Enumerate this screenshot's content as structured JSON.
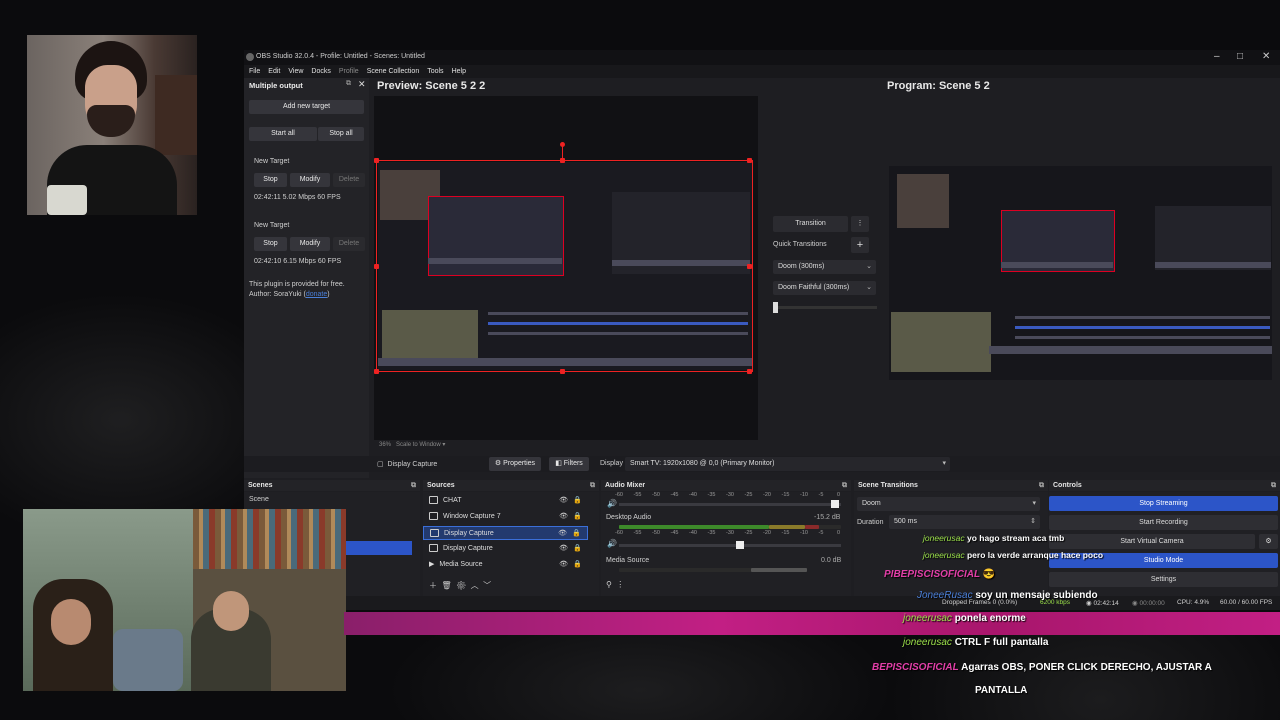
{
  "window": {
    "title": "OBS Studio 32.0.4 - Profile: Untitled - Scenes: Untitled",
    "controls": [
      "–",
      "□",
      "✕"
    ]
  },
  "menu": [
    "File",
    "Edit",
    "View",
    "Docks",
    "Profile",
    "Scene Collection",
    "Tools",
    "Help"
  ],
  "multiple_output": {
    "title": "Multiple output",
    "add_target": "Add new target",
    "start_all": "Start all",
    "stop_all": "Stop all",
    "targets": [
      {
        "name": "New Target",
        "stop": "Stop",
        "modify": "Modify",
        "delete": "Delete",
        "stats": "02:42:11  5.02 Mbps  60 FPS"
      },
      {
        "name": "New Target",
        "stop": "Stop",
        "modify": "Modify",
        "delete": "Delete",
        "stats": "02:42:10  6.15 Mbps  60 FPS"
      }
    ],
    "plugin_note": "This plugin is provided for free.",
    "author": "Author: SoraYuki (",
    "donate": "donate",
    "author_end": ")"
  },
  "preview": {
    "title": "Preview: Scene 5 2 2",
    "zoom": "36%",
    "scale_mode": "Scale to Window"
  },
  "program": {
    "title": "Program: Scene 5 2"
  },
  "transition": {
    "transition_label": "Transition",
    "quick_label": "Quick Transitions",
    "options": [
      "Doom (300ms)",
      "Doom Faithful (300ms)"
    ]
  },
  "source_toolbar": {
    "source_name": "Display Capture",
    "properties": "Properties",
    "filters": "Filters",
    "display_label": "Display",
    "display_value": "Smart TV: 1920x1080 @ 0,0 (Primary Monitor)"
  },
  "scenes": {
    "title": "Scenes",
    "items": [
      "Scene"
    ]
  },
  "sources": {
    "title": "Sources",
    "items": [
      "CHAT",
      "Window Capture 7",
      "Display Capture",
      "Display Capture",
      "Media Source"
    ]
  },
  "mixer": {
    "title": "Audio Mixer",
    "scale": [
      "-60",
      "-55",
      "-50",
      "-45",
      "-40",
      "-35",
      "-30",
      "-25",
      "-20",
      "-15",
      "-10",
      "-5",
      "0"
    ],
    "channels": [
      {
        "name": "Desktop Audio",
        "db": "-15.2 dB"
      },
      {
        "name": "Media Source",
        "db": "0.0 dB"
      }
    ]
  },
  "scene_transitions": {
    "title": "Scene Transitions",
    "selected": "Doom",
    "duration_label": "Duration",
    "duration_value": "500 ms"
  },
  "controls": {
    "title": "Controls",
    "buttons": [
      "Stop Streaming",
      "Start Recording",
      "Start Virtual Camera",
      "Studio Mode",
      "Settings"
    ]
  },
  "status": {
    "dropped": "Dropped Frames 0 (0.0%)",
    "bitrate": "6200 kbps",
    "live": "02:42:14",
    "rec": "00:00:00",
    "cpu": "CPU: 4.9%",
    "fps": "60.00 / 60.00 FPS"
  },
  "chat": [
    {
      "user": "joneerusac",
      "msg": "yo hago stream aca tmb"
    },
    {
      "user": "joneerusac",
      "msg": "pero la verde arranque hace poco"
    },
    {
      "user": "PIBEPISCISOFICIAL",
      "msg": "😎"
    },
    {
      "user": "JoneeRusac",
      "msg": "soy un mensaje subiendo"
    },
    {
      "user": "joneerusac",
      "msg": "ponela enorme"
    },
    {
      "user": "joneerusac",
      "msg": "CTRL F full pantalla"
    },
    {
      "user": "BEPISCISOFICIAL",
      "msg": "Agarras OBS, PONER CLICK DERECHO, AJUSTAR A",
      "msg2": "PANTALLA"
    }
  ],
  "colors": {
    "accent": "#2c55c8",
    "chat_pink": "#c21f84",
    "selection_red": "#e22222"
  }
}
